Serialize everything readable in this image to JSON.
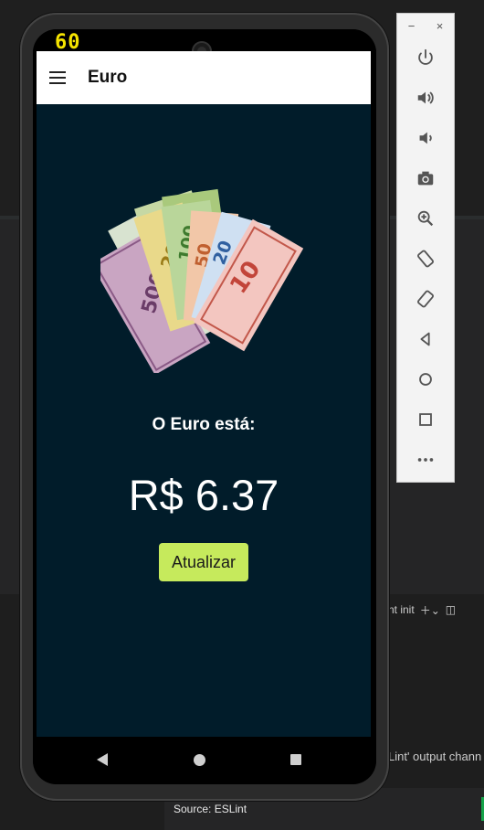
{
  "overlay": {
    "fps": "60"
  },
  "app": {
    "title": "Euro",
    "label": "O Euro está:",
    "price": "R$ 6.37",
    "button": "Atualizar",
    "colors": {
      "background": "#011c2a",
      "button": "#c6ea5c",
      "appbar": "#ffffff"
    }
  },
  "emulator_toolbar": {
    "window_controls": [
      "−",
      "×"
    ],
    "icons": [
      "power-icon",
      "volume-up-icon",
      "volume-down-icon",
      "camera-icon",
      "zoom-icon",
      "rotate-left-icon",
      "rotate-right-icon",
      "back-icon",
      "home-icon",
      "overview-icon",
      "more-icon"
    ]
  },
  "nav_bar": {
    "icons": [
      "back-triangle-icon",
      "home-circle-icon",
      "recents-square-icon"
    ]
  },
  "ide": {
    "panel_text": "nt init",
    "output_text": "Lint' output chann",
    "source_text": "Source: ESLint"
  }
}
